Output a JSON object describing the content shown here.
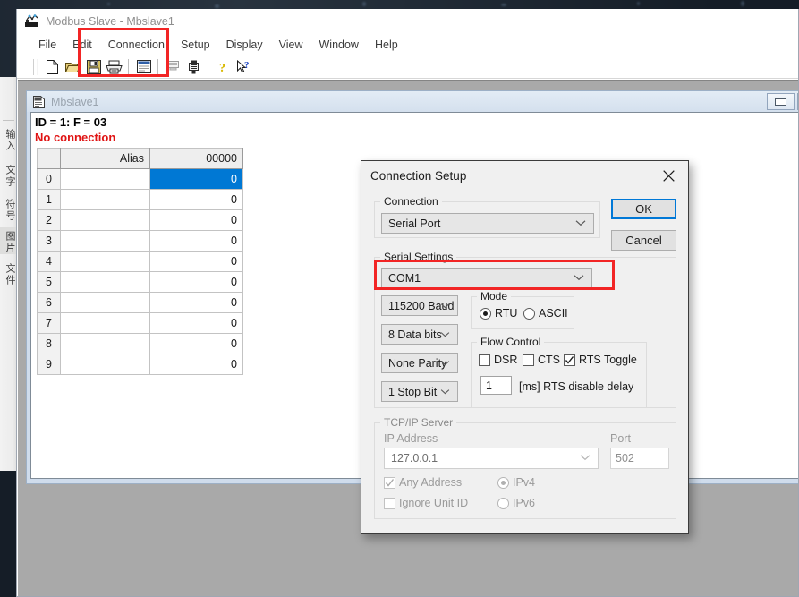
{
  "app": {
    "title": "Modbus Slave - Mbslave1",
    "icon": "modbus-app-icon"
  },
  "menubar": {
    "items": [
      {
        "label": "File",
        "name": "menu-file"
      },
      {
        "label": "Edit",
        "name": "menu-edit"
      },
      {
        "label": "Connection",
        "name": "menu-connection"
      },
      {
        "label": "Setup",
        "name": "menu-setup"
      },
      {
        "label": "Display",
        "name": "menu-display"
      },
      {
        "label": "View",
        "name": "menu-view"
      },
      {
        "label": "Window",
        "name": "menu-window"
      },
      {
        "label": "Help",
        "name": "menu-help"
      }
    ]
  },
  "toolbar": {
    "buttons": [
      {
        "name": "new-icon",
        "title": "New"
      },
      {
        "name": "open-folder-icon",
        "title": "Open"
      },
      {
        "name": "save-disk-icon",
        "title": "Save"
      },
      {
        "name": "print-icon",
        "title": "Print"
      },
      {
        "name": "window-icon",
        "title": "Display"
      },
      {
        "name": "tcp-connect-icon",
        "title": "Connect TCP"
      },
      {
        "name": "serial-connect-icon",
        "title": "Connect Serial"
      },
      {
        "name": "about-help-icon",
        "title": "About"
      },
      {
        "name": "context-help-icon",
        "title": "Context Help"
      }
    ]
  },
  "mdi_child": {
    "title": "Mbslave1",
    "icon": "document-icon",
    "status_line": "ID = 1: F = 03",
    "error_line": "No connection",
    "minimize_label": "minimize",
    "restore_label": "restore",
    "grid": {
      "headers": [
        "",
        "Alias",
        "00000"
      ],
      "rows": [
        {
          "index": "0",
          "alias": "",
          "value": "0",
          "selected": true
        },
        {
          "index": "1",
          "alias": "",
          "value": "0",
          "selected": false
        },
        {
          "index": "2",
          "alias": "",
          "value": "0",
          "selected": false
        },
        {
          "index": "3",
          "alias": "",
          "value": "0",
          "selected": false
        },
        {
          "index": "4",
          "alias": "",
          "value": "0",
          "selected": false
        },
        {
          "index": "5",
          "alias": "",
          "value": "0",
          "selected": false
        },
        {
          "index": "6",
          "alias": "",
          "value": "0",
          "selected": false
        },
        {
          "index": "7",
          "alias": "",
          "value": "0",
          "selected": false
        },
        {
          "index": "8",
          "alias": "",
          "value": "0",
          "selected": false
        },
        {
          "index": "9",
          "alias": "",
          "value": "0",
          "selected": false
        }
      ]
    }
  },
  "dialog": {
    "title": "Connection Setup",
    "close_label": "close",
    "ok_label": "OK",
    "cancel_label": "Cancel",
    "connection_group": {
      "legend": "Connection",
      "value": "Serial Port"
    },
    "serial_group": {
      "legend": "Serial Settings",
      "port": "COM1",
      "baud": "115200 Baud",
      "databits": "8 Data bits",
      "parity": "None Parity",
      "stopbits": "1 Stop Bit"
    },
    "mode_group": {
      "legend": "Mode",
      "rtu_label": "RTU",
      "ascii_label": "ASCII",
      "selected": "RTU"
    },
    "flow_group": {
      "legend": "Flow Control",
      "dsr_label": "DSR",
      "dsr_checked": false,
      "cts_label": "CTS",
      "cts_checked": false,
      "rts_label": "RTS Toggle",
      "rts_checked": true,
      "delay_value": "1",
      "delay_label": "[ms] RTS disable delay"
    },
    "tcp_group": {
      "legend": "TCP/IP Server",
      "ip_label": "IP Address",
      "ip_value": "127.0.0.1",
      "port_label": "Port",
      "port_value": "502",
      "any_address_label": "Any Address",
      "any_address_checked": true,
      "ignore_unit_label": "Ignore Unit ID",
      "ignore_unit_checked": false,
      "ipv4_label": "IPv4",
      "ipv6_label": "IPv6",
      "ip_version": "IPv4"
    }
  },
  "annotations": {
    "highlight_color": "#f22525",
    "boxes": [
      {
        "name": "highlight-connection-menu"
      },
      {
        "name": "highlight-com-port-combo"
      }
    ]
  },
  "side_strip": {
    "labels": [
      "输入",
      "文字",
      "符号",
      "图片",
      "文件"
    ]
  }
}
